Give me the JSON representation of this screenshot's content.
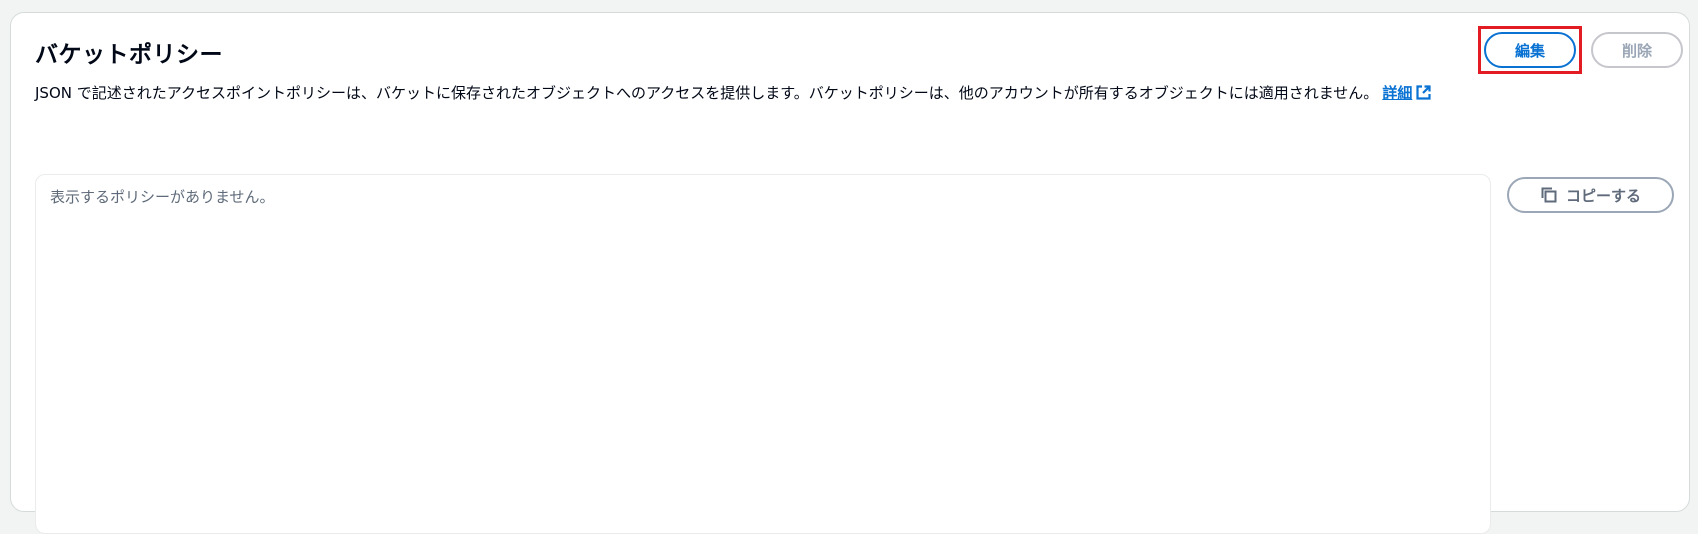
{
  "panel": {
    "title": "バケットポリシー",
    "description": "JSON で記述されたアクセスポイントポリシーは、バケットに保存されたオブジェクトへのアクセスを提供します。バケットポリシーは、他のアカウントが所有するオブジェクトには適用されません。",
    "learn_more_label": "詳細",
    "learn_more_icon": "external-link-icon"
  },
  "actions": {
    "edit_label": "編集",
    "delete_label": "削除",
    "copy_label": "コピーする",
    "copy_icon": "copy-icon"
  },
  "policy": {
    "empty_text": "表示するポリシーがありません。"
  },
  "colors": {
    "link": "#0972d3",
    "highlight": "#e31b23",
    "disabled": "#9ba7b6"
  }
}
